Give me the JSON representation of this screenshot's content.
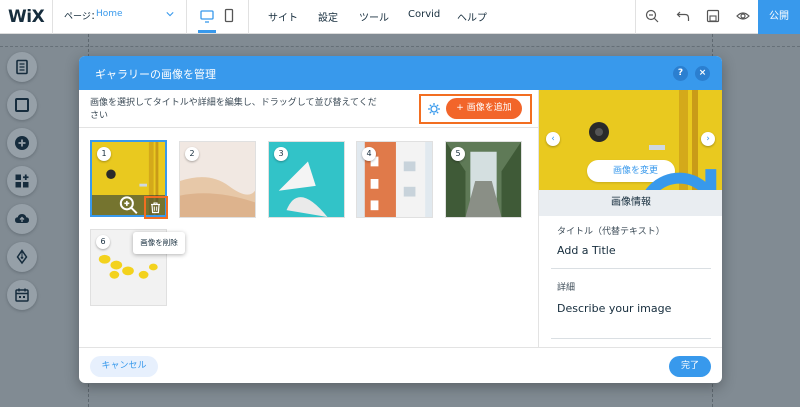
{
  "topbar": {
    "logo": "WiX",
    "page_label": "ページ：",
    "page_value": "Home",
    "menu": [
      "サイト",
      "設定",
      "ツール",
      "Corvid",
      "ヘルプ"
    ],
    "publish_label": "公開"
  },
  "dialog": {
    "title": "ギャラリーの画像を管理",
    "help_label": "?",
    "close_label": "×",
    "instructions": "画像を選択してタイトルや詳細を編集し、ドラッグして並び替えてください",
    "add_button": "+ 画像を追加",
    "images": [
      {
        "number": "1"
      },
      {
        "number": "2"
      },
      {
        "number": "3"
      },
      {
        "number": "4"
      },
      {
        "number": "5"
      },
      {
        "number": "6"
      }
    ],
    "delete_tooltip": "画像を削除",
    "cancel_button": "キャンセル",
    "done_button": "完了"
  },
  "panel": {
    "change_button": "画像を変更",
    "info_heading": "画像情報",
    "title_label": "タイトル（代替テキスト）",
    "title_value": "Add a Title",
    "desc_label": "詳細",
    "desc_value": "Describe your image",
    "prev_label": "‹",
    "next_label": "›"
  },
  "colors": {
    "accent": "#3899ec",
    "orange": "#f2652a",
    "highlight": "#f26e21"
  }
}
